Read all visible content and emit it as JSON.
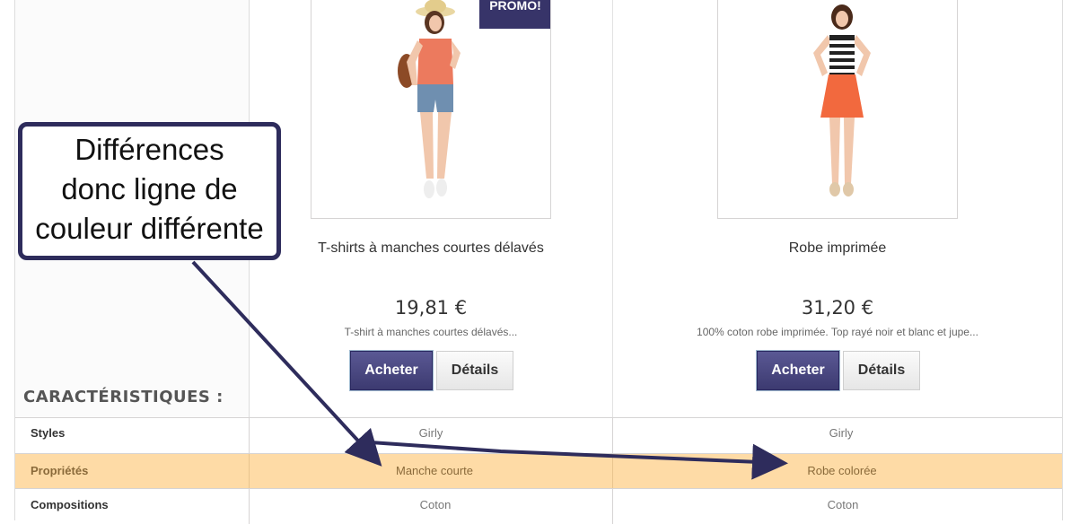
{
  "annotation": {
    "text_lines": [
      "Différences",
      "donc ligne de",
      "couleur différente"
    ]
  },
  "products": [
    {
      "promo": "PROMO!",
      "name": "T-shirts à manches courtes délavés",
      "price": "19,81 €",
      "description": "T-shirt à manches courtes délavés...",
      "buy_label": "Acheter",
      "details_label": "Détails"
    },
    {
      "name": "Robe imprimée",
      "price": "31,20 €",
      "description": "100% coton robe imprimée. Top rayé noir et blanc et jupe...",
      "buy_label": "Acheter",
      "details_label": "Détails"
    }
  ],
  "features": {
    "title": "CARACTÉRISTIQUES :",
    "rows": [
      {
        "label": "Styles",
        "values": [
          "Girly",
          "Girly"
        ],
        "highlighted": false
      },
      {
        "label": "Propriétés",
        "values": [
          "Manche courte",
          "Robe colorée"
        ],
        "highlighted": true
      },
      {
        "label": "Compositions",
        "values": [
          "Coton",
          "Coton"
        ],
        "highlighted": false
      }
    ]
  },
  "colors": {
    "brand": "#373469",
    "highlight_row": "#fedba6",
    "annotation_border": "#2e2c5c"
  }
}
